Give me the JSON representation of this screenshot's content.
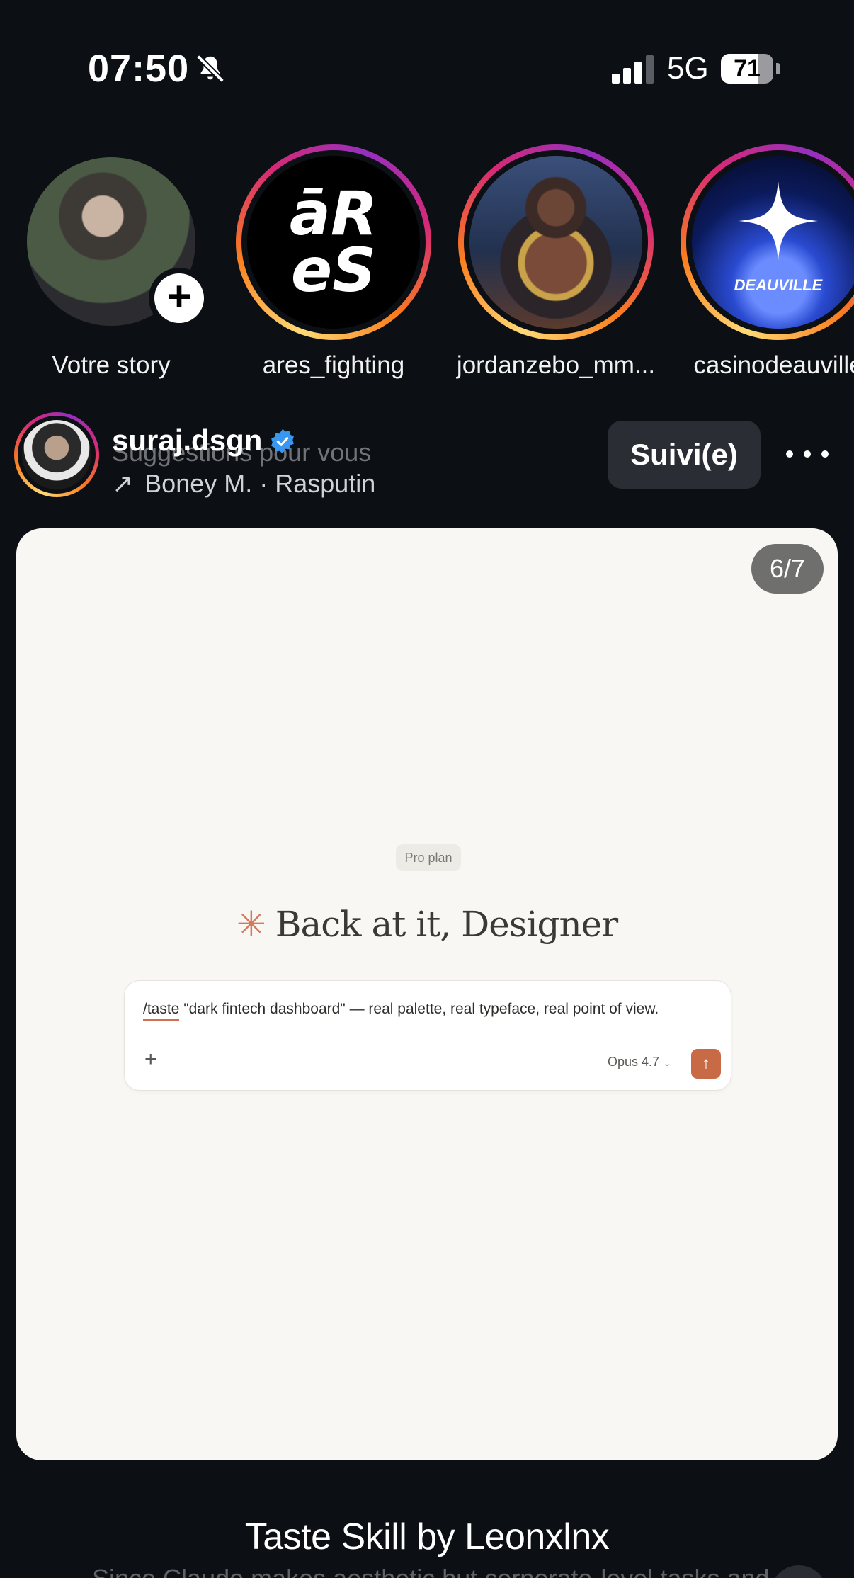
{
  "status_bar": {
    "time": "07:50",
    "network": "5G",
    "battery_level": "71",
    "battery_fraction": 0.71,
    "icons": [
      "bell-slash-icon",
      "signal-bars-icon",
      "battery-icon"
    ]
  },
  "stories": [
    {
      "label": "Votre story",
      "own": true
    },
    {
      "label": "ares_fighting",
      "logo_text_top": "āR",
      "logo_text_bottom": "eS"
    },
    {
      "label": "jordanzebo_mm..."
    },
    {
      "label": "casinodeauville",
      "logo_text": "DEAUVILLE"
    }
  ],
  "post": {
    "username": "suraj.dsgn",
    "verified": true,
    "suggestion": "Suggestions pour vous",
    "music": "Boney M. · Rasputin",
    "follow_label": "Suivi(e)",
    "counter": "6/7",
    "slide": {
      "plan": "Pro plan",
      "greeting": "Back at it, Designer",
      "prompt_command": "/taste",
      "prompt_rest": " \"dark fintech dashboard\" — real palette, real typeface, real point of view.",
      "model": "Opus 4.7",
      "accent": "#c96a47"
    },
    "caption_title": "Taste Skill by Leonxlnx",
    "caption_sub": "Since Claude makes aesthetic but corporate-level tasks and"
  },
  "colors": {
    "background": "#0c0f14",
    "card": "#f8f7f4",
    "verified": "#3897f0"
  }
}
